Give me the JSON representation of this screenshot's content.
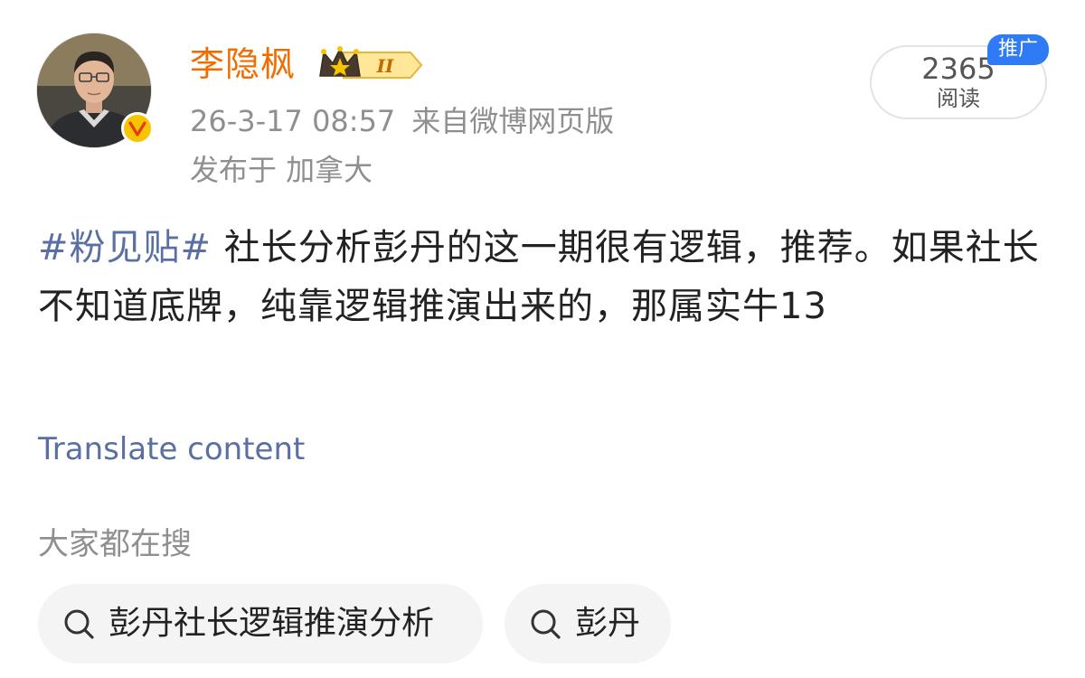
{
  "header": {
    "username": "李隐枫",
    "level_badge": "II",
    "timestamp": "26-3-17 08:57",
    "source": "来自微博网页版",
    "location": "发布于 加拿大"
  },
  "stats": {
    "read_count": "2365",
    "read_label": "阅读",
    "promo_tag": "推广"
  },
  "post": {
    "hashtag": "#粉见贴#",
    "text": " 社长分析彭丹的这一期很有逻辑，推荐。如果社长不知道底牌，纯靠逻辑推演出来的，那属实牛13",
    "translate_label": "Translate content"
  },
  "search": {
    "title": "大家都在搜",
    "chips": [
      {
        "label": "彭丹社长逻辑推演分析",
        "icon": "search-icon"
      },
      {
        "label": "彭丹",
        "icon": "search-icon"
      }
    ]
  },
  "colors": {
    "username": "#f06e00",
    "hashtag_link": "#5a6fa3",
    "meta_gray": "#8f8f8f",
    "promo_blue": "#2f7bf5",
    "verified_gold": "#f7c500",
    "chip_bg": "#f4f4f4"
  }
}
